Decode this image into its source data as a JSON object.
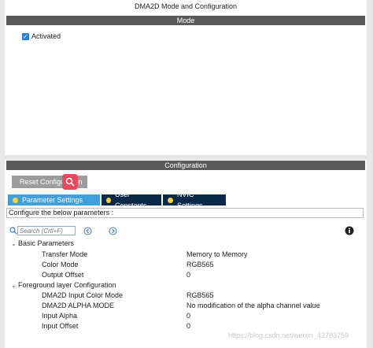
{
  "window_title": "DMA2D Mode and Configuration",
  "mode_section": {
    "header": "Mode",
    "activated_label": "Activated",
    "activated_checked": true
  },
  "config_section": {
    "header": "Configuration",
    "reset_button": "Reset Configuration",
    "tabs": [
      {
        "label": "Parameter Settings",
        "active": true
      },
      {
        "label": "User Constants",
        "active": false
      },
      {
        "label": "NVIC Settings",
        "active": false
      }
    ],
    "description": "Configure the below parameters :",
    "search_placeholder": "Search (Crtl+F)",
    "groups": [
      {
        "name": "Basic Parameters",
        "params": [
          {
            "name": "Transfer Mode",
            "value": "Memory to Memory"
          },
          {
            "name": "Color Mode",
            "value": "RGB565"
          },
          {
            "name": "Output Offset",
            "value": "0"
          }
        ]
      },
      {
        "name": "Foreground layer Configuration",
        "params": [
          {
            "name": "DMA2D Input Color Mode",
            "value": "RGB565"
          },
          {
            "name": "DMA2D ALPHA MODE",
            "value": "No modification of the alpha channel value"
          },
          {
            "name": "Input Alpha",
            "value": "0"
          },
          {
            "name": "Input Offset",
            "value": "0"
          }
        ]
      }
    ]
  },
  "watermark": "https://blog.csdn.net/weixin_42783759",
  "icons": [
    "search-icon",
    "prev-result-icon",
    "next-result-icon",
    "info-icon",
    "zoom-icon",
    "expand-arrow-icon"
  ],
  "colors": {
    "section_header": "#5a5a5a",
    "tab_active": "#3ea0dc",
    "tab_inactive": "#0b2a4a",
    "tab_dot": "#f5d33b",
    "checkbox": "#2f7fd0",
    "zoom_badge": "#e84a5f"
  }
}
